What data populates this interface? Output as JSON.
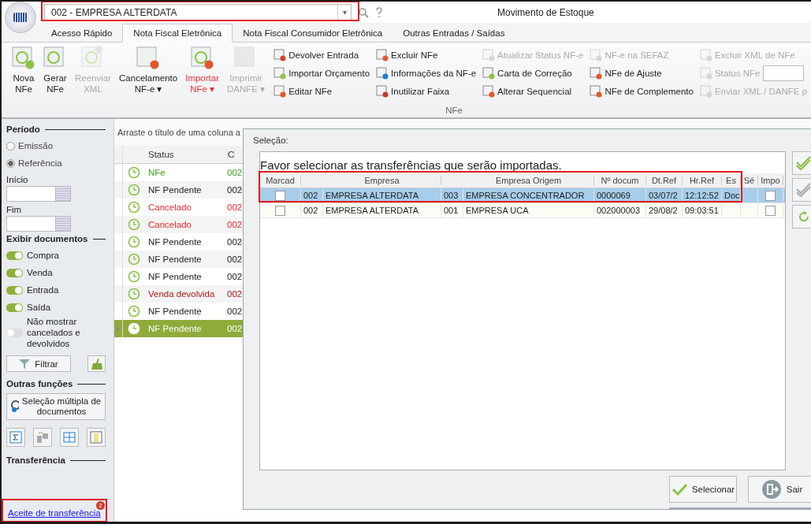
{
  "window": {
    "title": "Movimento de Estoque",
    "company": "002 - EMPRESA ALTERDATA",
    "company_caret": "▾"
  },
  "tabs": [
    {
      "label": "Acesso Rápido",
      "selected": false
    },
    {
      "label": "Nota Fiscal Eletrônica",
      "selected": true
    },
    {
      "label": "Nota Fiscal Consumidor Eletrônica",
      "selected": false
    },
    {
      "label": "Outras Entradas / Saídas",
      "selected": false
    }
  ],
  "ribbon": {
    "group": "NFe",
    "large": [
      {
        "label": "Nova\nNFe",
        "disabled": false,
        "highlight": false
      },
      {
        "label": "Gerar\nNFe",
        "disabled": false,
        "highlight": false
      },
      {
        "label": "Reenviar\nXML",
        "disabled": true,
        "highlight": false
      },
      {
        "label": "Cancelamento\nNF-e ▾",
        "disabled": false,
        "highlight": false
      },
      {
        "label": "Importar\nNFe ▾",
        "disabled": false,
        "highlight": true
      },
      {
        "label": "Imprimir\nDANFE ▾",
        "disabled": true,
        "highlight": false
      }
    ],
    "columns": [
      [
        {
          "label": "Devolver Entrada",
          "disabled": false
        },
        {
          "label": "Importar Orçamento",
          "disabled": false
        },
        {
          "label": "Editar NFe",
          "disabled": false
        }
      ],
      [
        {
          "label": "Excluir NFe",
          "disabled": false
        },
        {
          "label": "Informações da NF-e",
          "disabled": false
        },
        {
          "label": "Inutilizar Faixa",
          "disabled": false
        }
      ],
      [
        {
          "label": "Atualizar Status NF-e",
          "disabled": true
        },
        {
          "label": "Carta de Correção",
          "disabled": false
        },
        {
          "label": "Alterar Sequencial",
          "disabled": false
        }
      ],
      [
        {
          "label": "NF-e na SEFAZ",
          "disabled": true
        },
        {
          "label": "NFe de Ajuste",
          "disabled": false
        },
        {
          "label": "NFe de Complemento",
          "disabled": false
        }
      ],
      [
        {
          "label": "Excluir XML de NFe",
          "disabled": true
        },
        {
          "label": "Status NFe",
          "disabled": true,
          "field": true
        },
        {
          "label": "Enviar XML / DANFE p",
          "disabled": true
        }
      ]
    ]
  },
  "sidebar": {
    "period_title": "Período",
    "period": [
      {
        "label": "Emissão",
        "selected": false
      },
      {
        "label": "Referência",
        "selected": true
      }
    ],
    "start_label": "Início",
    "end_label": "Fim",
    "docs_title": "Exibir documentos",
    "toggles": [
      {
        "label": "Compra",
        "on": true
      },
      {
        "label": "Venda",
        "on": true
      },
      {
        "label": "Entrada",
        "on": true
      },
      {
        "label": "Saída",
        "on": true
      },
      {
        "label": "Não mostrar cancelados e devolvidos",
        "on": false
      }
    ],
    "filter_button": "Filtrar",
    "other_title": "Outras funções",
    "multi_button": "Seleção múltipla de documentos",
    "transfer_title": "Transferência",
    "transfer_link": "Aceite de transferência",
    "transfer_badge": "2"
  },
  "grid": {
    "group_hint": "Arraste o título de uma coluna a",
    "columns": [
      "Status",
      "C"
    ],
    "rows": [
      {
        "status": "NFe",
        "code": "002",
        "color": "#3c9a1c",
        "selected": false
      },
      {
        "status": "NF Pendente",
        "code": "002",
        "color": "#222222",
        "selected": false
      },
      {
        "status": "Cancelado",
        "code": "002",
        "color": "#e8282c",
        "selected": false
      },
      {
        "status": "Cancelado",
        "code": "002",
        "color": "#e8282c",
        "selected": false
      },
      {
        "status": "NF Pendente",
        "code": "002",
        "color": "#222222",
        "selected": false
      },
      {
        "status": "NF Pendente",
        "code": "002",
        "color": "#222222",
        "selected": false
      },
      {
        "status": "NF Pendente",
        "code": "002",
        "color": "#222222",
        "selected": false
      },
      {
        "status": "Venda devolvida",
        "code": "002",
        "color": "#b01818",
        "selected": false
      },
      {
        "status": "NF Pendente",
        "code": "002",
        "color": "#222222",
        "selected": false
      },
      {
        "status": "NF Pendente",
        "code": "002",
        "color": "#ffffff",
        "selected": true
      }
    ]
  },
  "dialog": {
    "title": "Seleção:",
    "prompt": "Favor selecionar as transferências que serão importadas.",
    "check_column": "Marcad",
    "columns": [
      "",
      "Empresa",
      "",
      "Empresa Origem",
      "Nº docum",
      "Dt.Ref",
      "Hr.Ref",
      "Es",
      "Sé"
    ],
    "import_column": "Impo",
    "rows": [
      {
        "checked": false,
        "cells": [
          "002",
          "EMPRESA ALTERDATA",
          "003",
          "EMPRESA CONCENTRADOR",
          "0000069",
          "03/07/2",
          "12:12:52",
          "Doc",
          ""
        ],
        "import": false,
        "selected": true
      },
      {
        "checked": false,
        "cells": [
          "002",
          "EMPRESA ALTERDATA",
          "001",
          "EMPRESA UCA",
          "002000003",
          "29/08/2",
          "09:03:51",
          "",
          ""
        ],
        "import": false,
        "selected": false
      }
    ],
    "buttons": [
      "Selecionar",
      "Sair"
    ]
  }
}
